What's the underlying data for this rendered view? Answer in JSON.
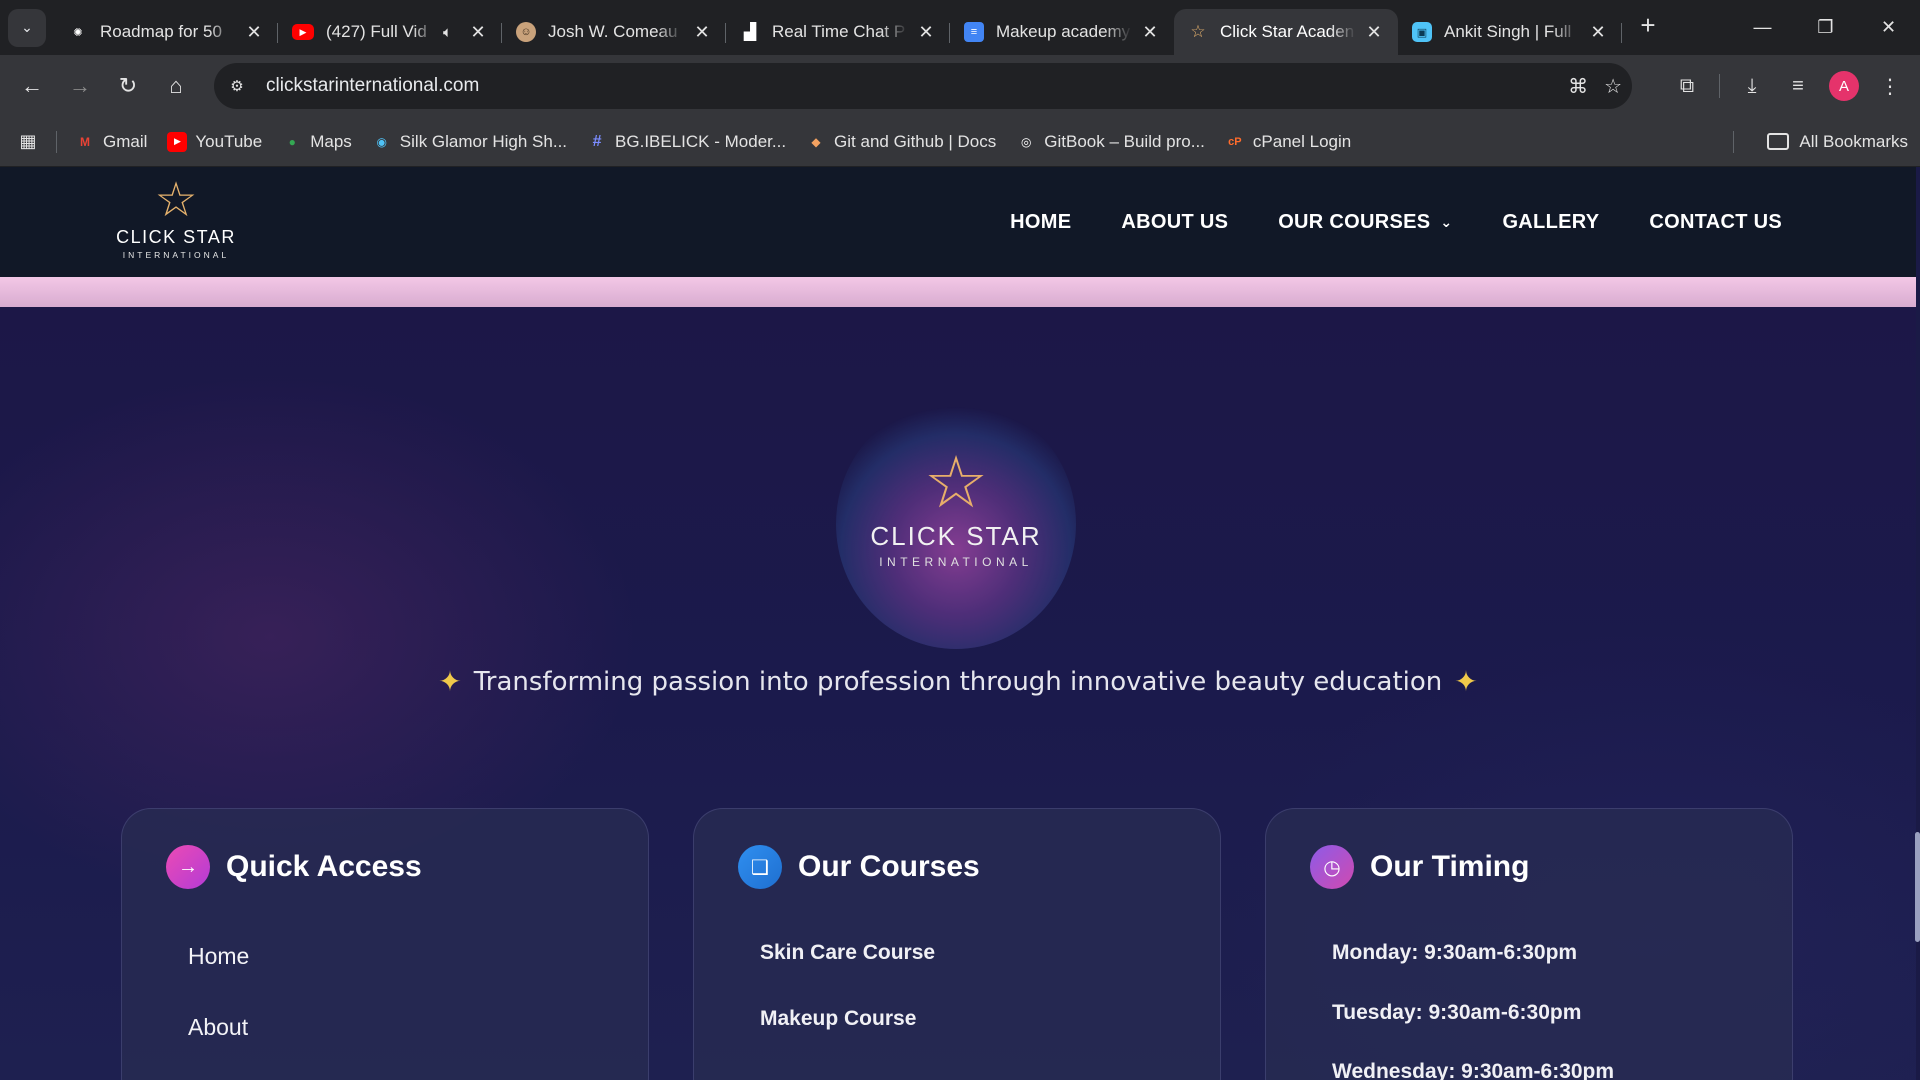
{
  "browser": {
    "tabs": [
      {
        "title": "Roadmap for 50",
        "favicon": "openai-icon",
        "favicon_color": "#ffffff"
      },
      {
        "title": "(427) Full Vid",
        "favicon": "youtube-icon",
        "favicon_color": "#ff0000"
      },
      {
        "title": "Josh W. Comeau",
        "favicon": "avatar-icon",
        "favicon_color": "#c9a27b"
      },
      {
        "title": "Real Time Chat P",
        "favicon": "building-icon",
        "favicon_color": "#ffffff"
      },
      {
        "title": "Makeup academy",
        "favicon": "forms-icon",
        "favicon_color": "#4285f4"
      },
      {
        "title": "Click Star Acaden",
        "favicon": "star-icon",
        "favicon_color": "#e6b26d",
        "active": true
      },
      {
        "title": "Ankit Singh | Full",
        "favicon": "briefcase-icon",
        "favicon_color": "#4fc3f7"
      }
    ],
    "url": "clickstarinternational.com",
    "avatar_letter": "A",
    "bookmarks": [
      {
        "label": "Gmail",
        "icon": "M",
        "color": "#ea4335"
      },
      {
        "label": "YouTube",
        "icon": "▶",
        "color": "#ff0000"
      },
      {
        "label": "Maps",
        "icon": "●",
        "color": "#34a853"
      },
      {
        "label": "Silk Glamor High Sh...",
        "icon": "◉",
        "color": "#4fc3f7"
      },
      {
        "label": "BG.IBELICK - Moder...",
        "icon": "#",
        "color": "#7b8cff"
      },
      {
        "label": "Git and Github | Docs",
        "icon": "◆",
        "color": "#f4a261"
      },
      {
        "label": "GitBook – Build pro...",
        "icon": "◎",
        "color": "#ffffff"
      },
      {
        "label": "cPanel Login",
        "icon": "cP",
        "color": "#ff6c2c"
      }
    ],
    "all_bookmarks": "All Bookmarks"
  },
  "site": {
    "logo": {
      "brand": "CLICK STAR",
      "sub": "INTERNATIONAL"
    },
    "nav": [
      "HOME",
      "ABOUT US",
      "OUR COURSES",
      "GALLERY",
      "CONTACT US"
    ],
    "tagline": "Transforming passion into profession through innovative beauty education",
    "cards": [
      {
        "title": "Quick Access",
        "icon": "arrow-right-icon",
        "items": [
          "Home",
          "About"
        ]
      },
      {
        "title": "Our Courses",
        "icon": "book-icon",
        "items": [
          "Skin Care Course",
          "Makeup Course"
        ]
      },
      {
        "title": "Our Timing",
        "icon": "clock-icon",
        "items": [
          "Monday: 9:30am-6:30pm",
          "Tuesday: 9:30am-6:30pm",
          "Wednesday: 9:30am-6:30pm"
        ]
      }
    ]
  }
}
